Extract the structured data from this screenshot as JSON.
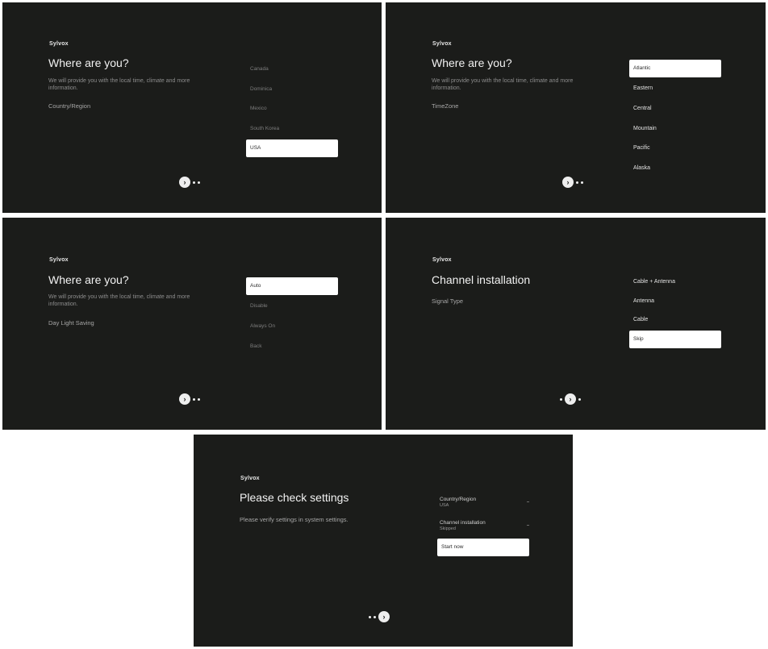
{
  "brand": "Sylvox",
  "screens": [
    {
      "title": "Where are you?",
      "description": "We will provide you with the local time, climate and more information.",
      "subtitle": "Country/Region",
      "options": [
        "Canada",
        "Dominica",
        "Mexico",
        "South Korea",
        "USA"
      ],
      "selected_index": 4
    },
    {
      "title": "Where are you?",
      "description": "We will provide you with the local time, climate and more information.",
      "subtitle": "TimeZone",
      "options": [
        "Atlantic",
        "Eastern",
        "Central",
        "Mountain",
        "Pacific",
        "Alaska"
      ],
      "selected_index": 0
    },
    {
      "title": "Where are you?",
      "description": "We will provide you with the local time, climate and more information.",
      "subtitle": "Day Light Saving",
      "options": [
        "Auto",
        "Disable",
        "Always On",
        "Back"
      ],
      "selected_index": 0
    },
    {
      "title": "Channel installation",
      "subtitle": "Signal Type",
      "options": [
        "Cable + Antenna",
        "Antenna",
        "Cable",
        "Skip"
      ],
      "selected_index": 3
    },
    {
      "title": "Please check settings",
      "subtitle": "Please verify settings in system settings.",
      "summary": [
        {
          "label": "Country/Region",
          "value": "USA"
        },
        {
          "label": "Channel installation",
          "value": "Skipped"
        }
      ],
      "action": "Start now"
    }
  ],
  "icons": {
    "next": "chevron-right-icon",
    "page_dot": "page-dot"
  }
}
